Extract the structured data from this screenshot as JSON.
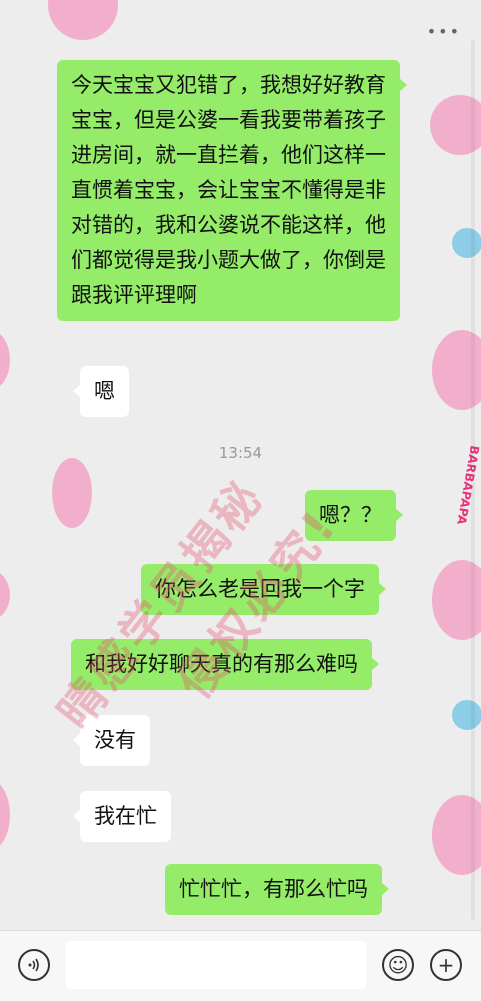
{
  "menu": {
    "dots": "•••"
  },
  "messages": [
    {
      "from": "me",
      "text": "今天宝宝又犯错了，我想好好教育宝宝，但是公婆一看我要带着孩子进房间，就一直拦着，他们这样一直惯着宝宝，会让宝宝不懂得是非对错的，我和公婆说不能这样，他们都觉得是我小题大做了，你倒是跟我评评理啊"
    },
    {
      "from": "other",
      "text": "嗯"
    },
    {
      "from": "me",
      "text": "嗯？？"
    },
    {
      "from": "me",
      "text": "你怎么老是回我一个字"
    },
    {
      "from": "me",
      "text": "和我好好聊天真的有那么难吗"
    },
    {
      "from": "other",
      "text": "没有"
    },
    {
      "from": "other",
      "text": "我在忙"
    },
    {
      "from": "me",
      "text": "忙忙忙，有那么忙吗"
    }
  ],
  "timestamp": "13:54",
  "watermark": {
    "line1": "晴感学员揭秘",
    "line2": "侵权必究!"
  },
  "wallpaper": {
    "sticker_text": "BARBAPAPA"
  },
  "input_bar": {
    "voice_icon": "voice-icon",
    "emoji_icon": "emoji-icon",
    "plus_icon": "plus-icon",
    "emoji_glyph": "☺",
    "plus_glyph": "+"
  },
  "colors": {
    "my_bubble": "#95ec69",
    "other_bubble": "#ffffff",
    "background": "#ededed"
  }
}
